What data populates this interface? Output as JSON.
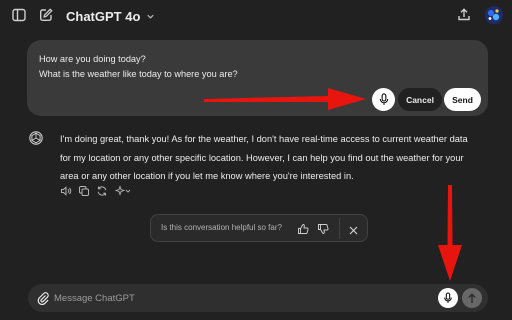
{
  "header": {
    "model_name": "ChatGPT 4o",
    "icons": [
      "sidebar-icon",
      "new-chat-icon",
      "chevron-down-icon",
      "share-icon",
      "avatar"
    ]
  },
  "edit": {
    "lines": [
      "How are you doing today?",
      "What is the weather like today to where you are?"
    ],
    "cancel_label": "Cancel",
    "send_label": "Send"
  },
  "assistant": {
    "lines": [
      "I'm doing great, thank you! As for the weather, I don't have real-time access to current weather data",
      "for my location or any other specific location. However, I can help you find out the weather for your",
      "area or any other location if you let me know where you're interested in."
    ],
    "actions": [
      "read-aloud-icon",
      "copy-icon",
      "regenerate-icon",
      "sparkle-icon",
      "chevron-down-icon"
    ]
  },
  "feedback": {
    "question": "Is this conversation helpful so far?"
  },
  "composer": {
    "placeholder": "Message ChatGPT",
    "value": ""
  },
  "colors": {
    "background": "#212121",
    "bubble": "#3a3a3a",
    "annotation_arrow": "#e8150f"
  }
}
